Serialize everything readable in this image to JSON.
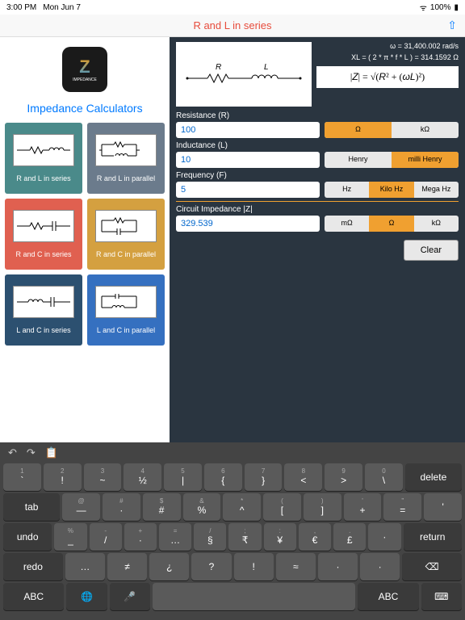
{
  "status": {
    "time": "3:00 PM",
    "date": "Mon Jun 7",
    "wifi": "100%"
  },
  "nav": {
    "title": "R and L in series"
  },
  "sidebar": {
    "title": "Impedance Calculators",
    "logo_label": "IMPEDANCE",
    "cards": [
      {
        "label": "R and L in series",
        "color": "teal"
      },
      {
        "label": "R and L in parallel",
        "color": "slate"
      },
      {
        "label": "R and C in series",
        "color": "coral"
      },
      {
        "label": "R and C in parallel",
        "color": "gold"
      },
      {
        "label": "L and C in series",
        "color": "navy"
      },
      {
        "label": "L and C in parallel",
        "color": "blue"
      }
    ]
  },
  "detail": {
    "omega": "ω = 31,400.002 rad/s",
    "xl": "XL = ( 2 * π * f * L ) = 314.1592 Ω",
    "formula": "|Z| = √(R² + (ωL)²)",
    "resistance": {
      "label": "Resistance (R)",
      "value": "100",
      "units": [
        "Ω",
        "kΩ"
      ],
      "active": 0
    },
    "inductance": {
      "label": "Inductance (L)",
      "value": "10",
      "units": [
        "Henry",
        "milli Henry"
      ],
      "active": 1
    },
    "frequency": {
      "label": "Frequency (F)",
      "value": "5",
      "units": [
        "Hz",
        "Kilo Hz",
        "Mega Hz"
      ],
      "active": 1
    },
    "impedance": {
      "label": "Circuit Impedance |Z|",
      "value": "329.539",
      "units": [
        "mΩ",
        "Ω",
        "kΩ"
      ],
      "active": 1
    },
    "clear": "Clear",
    "r_sym": "R",
    "l_sym": "L"
  },
  "keyboard": {
    "row1_sup": [
      "1",
      "2",
      "3",
      "4",
      "5",
      "6",
      "7",
      "8",
      "9",
      "0"
    ],
    "row1": [
      "`",
      "!",
      "~",
      "½",
      "|",
      "{",
      "}",
      "<",
      ">",
      "\\"
    ],
    "delete": "delete",
    "tab": "tab",
    "row2_sup": [
      "@",
      "#",
      "$",
      "&",
      "*",
      "(",
      ")",
      "'",
      "\""
    ],
    "row2": [
      "—",
      "·",
      "#",
      "%",
      "^",
      "[",
      "]",
      "+",
      "=",
      "'"
    ],
    "undo": "undo",
    "row3_sup": [
      "%",
      "-",
      "+",
      "=",
      "/",
      ";",
      ":",
      ",",
      "."
    ],
    "row3": [
      "_",
      "/",
      "·",
      "…",
      "§",
      "₹",
      "¥",
      "€",
      "£",
      "·"
    ],
    "return": "return",
    "redo": "redo",
    "row4": [
      "…",
      "≠",
      "¿",
      "?",
      "!",
      "≈",
      "·",
      "·"
    ],
    "abc": "ABC"
  }
}
